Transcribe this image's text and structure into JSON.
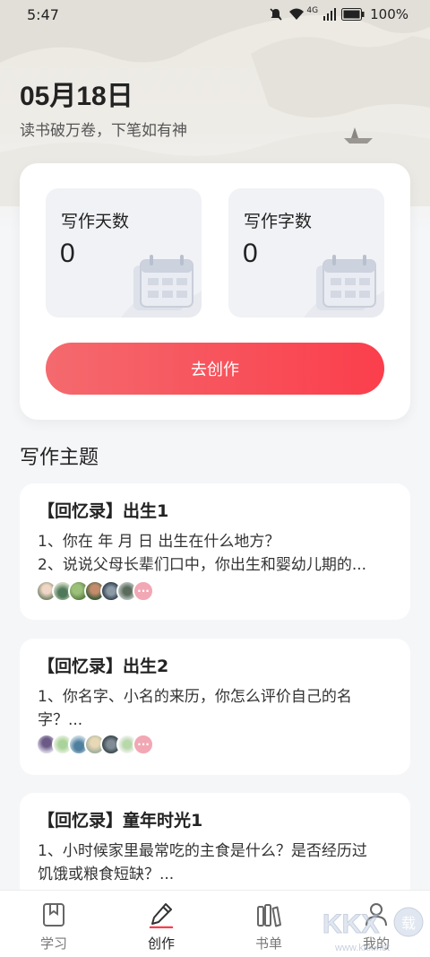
{
  "status_bar": {
    "time": "5:47",
    "network": "4G",
    "battery": "100%",
    "icons": [
      "mute-bell-icon",
      "wifi-icon",
      "signal-icon",
      "battery-icon"
    ]
  },
  "header": {
    "date": "05月18日",
    "slogan": "读书破万卷，下笔如有神"
  },
  "stats": {
    "days_label": "写作天数",
    "days_value": "0",
    "words_label": "写作字数",
    "words_value": "0",
    "create_button": "去创作"
  },
  "topics_section": {
    "title": "写作主题",
    "items": [
      {
        "title": "【回忆录】出生1",
        "lines": [
          "1、你在  年  月  日 出生在什么地方？",
          "2、说说父母长辈们口中，你出生和婴幼儿期的..."
        ]
      },
      {
        "title": "【回忆录】出生2",
        "lines": [
          "1、你名字、小名的来历，你怎么评价自己的名",
          "字？..."
        ]
      },
      {
        "title": "【回忆录】童年时光1",
        "lines": [
          "1、小时候家里最常吃的主食是什么？是否经历过",
          "饥饿或粮食短缺？..."
        ]
      }
    ]
  },
  "tab_bar": {
    "tabs": [
      {
        "label": "学习",
        "icon": "bookmark-book-icon"
      },
      {
        "label": "创作",
        "icon": "pen-icon"
      },
      {
        "label": "书单",
        "icon": "bookshelf-icon"
      },
      {
        "label": "我的",
        "icon": "user-icon"
      }
    ],
    "active_index": 1
  },
  "colors": {
    "accent": "#fb3e4c",
    "accent_light": "#f46a6e",
    "more_avatar": "#f2a7b4"
  },
  "watermark": "KKX 下载 www.kkx.net"
}
